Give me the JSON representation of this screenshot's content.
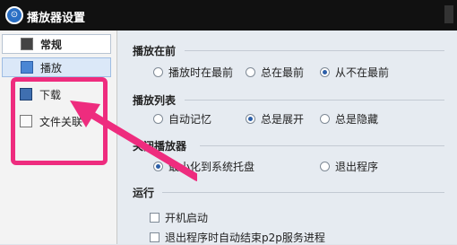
{
  "window": {
    "title": "播放器设置"
  },
  "sidebar": {
    "items": [
      {
        "label": "常规",
        "icon": "monitor-icon"
      },
      {
        "label": "播放",
        "icon": "play-icon"
      },
      {
        "label": "下载",
        "icon": "download-icon"
      },
      {
        "label": "文件关联",
        "icon": "file-icon"
      }
    ]
  },
  "annotation": {
    "color": "#ee2c7e"
  },
  "settings": {
    "playing_front": {
      "title": "播放在前",
      "options": [
        {
          "label": "播放时在最前",
          "selected": false
        },
        {
          "label": "总在最前",
          "selected": false
        },
        {
          "label": "从不在最前",
          "selected": true
        }
      ]
    },
    "playlist": {
      "title": "播放列表",
      "options": [
        {
          "label": "自动记忆",
          "selected": false
        },
        {
          "label": "总是展开",
          "selected": true
        },
        {
          "label": "总是隐藏",
          "selected": false
        }
      ]
    },
    "close_player": {
      "title": "关闭播放器",
      "options": [
        {
          "label": "最小化到系统托盘",
          "selected": true
        },
        {
          "label": "退出程序",
          "selected": false
        }
      ]
    },
    "run": {
      "title": "运行",
      "options": [
        {
          "label": "开机启动",
          "checked": false
        },
        {
          "label": "退出程序时自动结束p2p服务进程",
          "checked": false
        }
      ]
    }
  }
}
